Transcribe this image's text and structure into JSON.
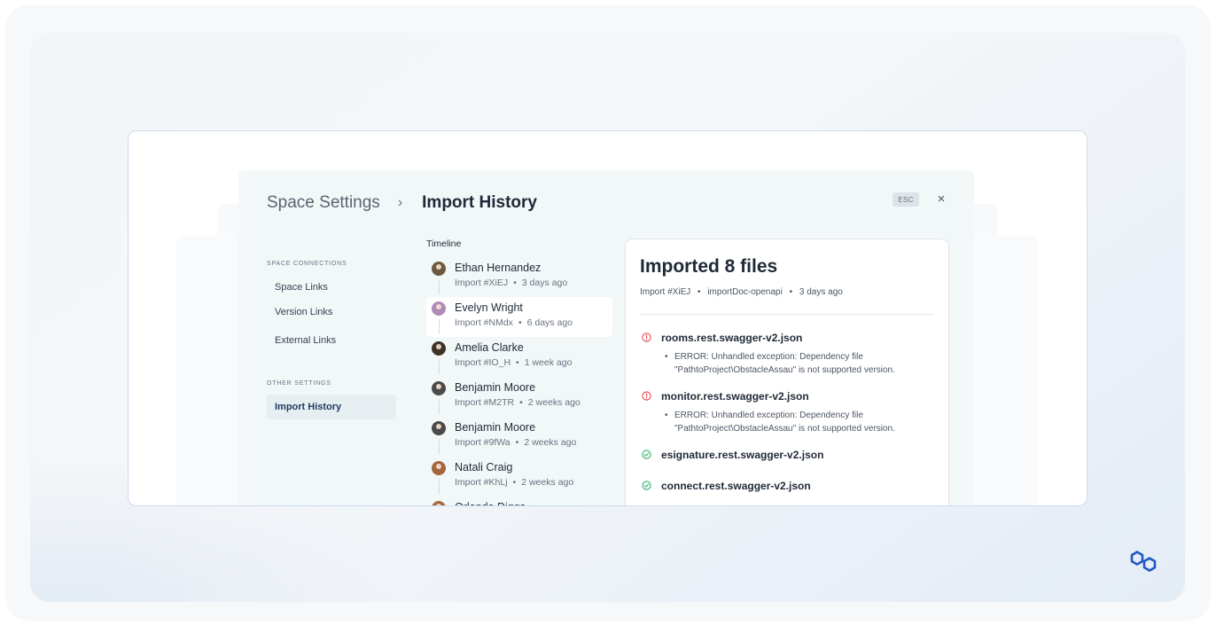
{
  "dialog": {
    "breadcrumb_root": "Space Settings",
    "breadcrumb_separator": "›",
    "breadcrumb_current": "Import History",
    "esc_label": "ESC",
    "close_label": "×"
  },
  "nav": {
    "groups": [
      {
        "label": "SPACE CONNECTIONS",
        "items": [
          "Space Links",
          "Version Links",
          "External Links"
        ]
      },
      {
        "label": "OTHER SETTINGS",
        "items": [
          "Import History"
        ]
      }
    ],
    "active_item": "Import History"
  },
  "timeline": {
    "title": "Timeline",
    "entries": [
      {
        "name": "Ethan Hernandez",
        "import_id": "Import #XiEJ",
        "time": "3 days ago",
        "avatar_color": "#6b5a3e"
      },
      {
        "name": "Evelyn Wright",
        "import_id": "Import #NMdx",
        "time": "6 days ago",
        "avatar_color": "#b08ab8"
      },
      {
        "name": "Amelia Clarke",
        "import_id": "Import #IO_H",
        "time": "1 week ago",
        "avatar_color": "#3e3327"
      },
      {
        "name": "Benjamin Moore",
        "import_id": "Import #M2TR",
        "time": "2 weeks ago",
        "avatar_color": "#4a4a4a"
      },
      {
        "name": "Benjamin Moore",
        "import_id": "Import #9fWa",
        "time": "2 weeks ago",
        "avatar_color": "#4a4a4a"
      },
      {
        "name": "Natali Craig",
        "import_id": "Import #KhLj",
        "time": "2 weeks ago",
        "avatar_color": "#a3663f"
      },
      {
        "name": "Orlando Diggs",
        "import_id": "",
        "time": "",
        "avatar_color": "#a3663f"
      }
    ],
    "separator": "•"
  },
  "detail": {
    "title": "Imported 8 files",
    "meta_import": "Import #XiEJ",
    "meta_doc": "importDoc-openapi",
    "meta_time": "3 days ago",
    "files": [
      {
        "name": "rooms.rest.swagger-v2.json",
        "status": "error",
        "icon": "error-circle-icon",
        "message": "ERROR: Unhandled exception: Dependency file \"PathtoProject\\ObstacleAssau\" is not supported version."
      },
      {
        "name": "monitor.rest.swagger-v2.json",
        "status": "error",
        "icon": "error-circle-icon",
        "message": "ERROR: Unhandled exception: Dependency file \"PathtoProject\\ObstacleAssau\" is not supported version."
      },
      {
        "name": "esignature.rest.swagger-v2.json",
        "status": "success",
        "icon": "check-circle-icon",
        "message": ""
      },
      {
        "name": "connect.rest.swagger-v2.json",
        "status": "success",
        "icon": "check-circle-icon",
        "message": ""
      }
    ]
  },
  "colors": {
    "error": "#e5484d",
    "success": "#2fb36b",
    "accent": "#1e3a5f",
    "brand": "#2563eb"
  },
  "brand": {
    "icon": "hexagon-link-logo-icon"
  }
}
